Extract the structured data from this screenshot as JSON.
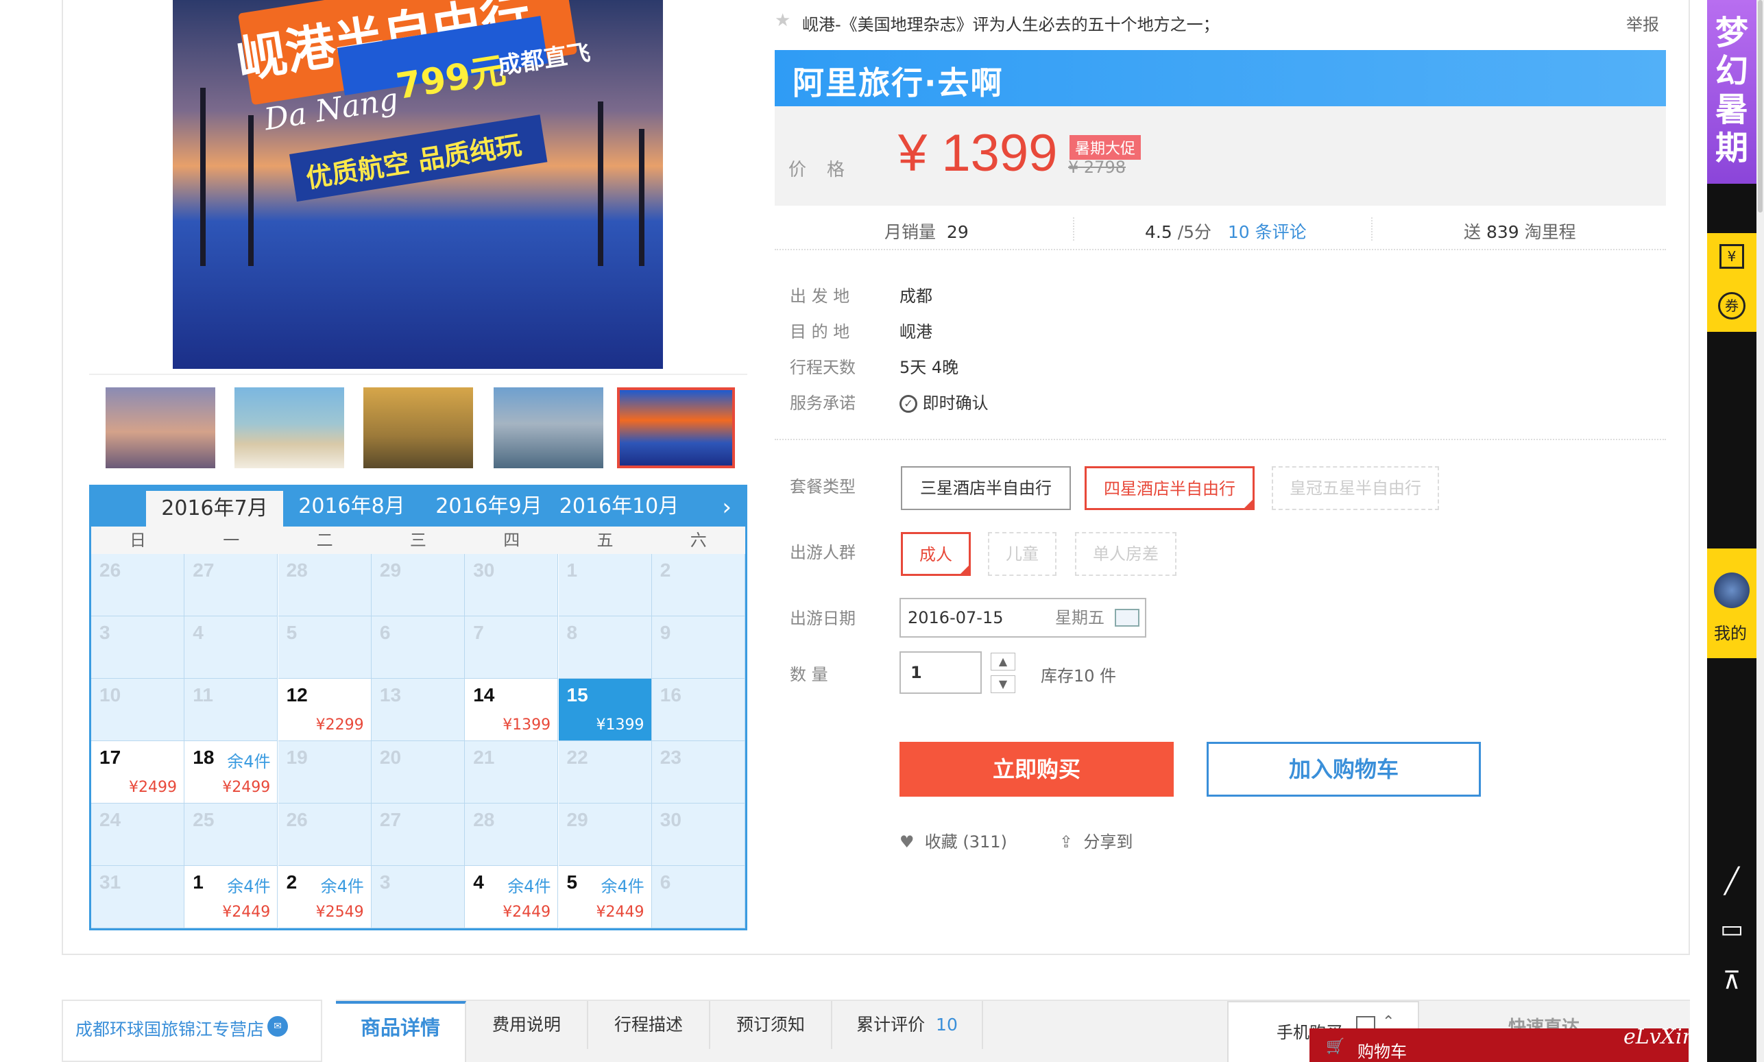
{
  "header": {
    "top_line": "岘港-《美国地理杂志》评为人生必去的五十个地方之一；",
    "report": "举报"
  },
  "gallery": {
    "banner_title": "岘港半自由行",
    "banner_price": "799元",
    "banner_flight": "成都直飞",
    "banner_script": "Da Nang",
    "banner_slogan": "优质航空  品质纯玩"
  },
  "calendar": {
    "months": [
      "2016年7月",
      "2016年8月",
      "2016年9月",
      "2016年10月"
    ],
    "active_month_index": 0,
    "weekdays": [
      "日",
      "一",
      "二",
      "三",
      "四",
      "五",
      "六"
    ],
    "rows": [
      [
        {
          "d": "26"
        },
        {
          "d": "27"
        },
        {
          "d": "28"
        },
        {
          "d": "29"
        },
        {
          "d": "30"
        },
        {
          "d": "1"
        },
        {
          "d": "2"
        }
      ],
      [
        {
          "d": "3"
        },
        {
          "d": "4"
        },
        {
          "d": "5"
        },
        {
          "d": "6"
        },
        {
          "d": "7"
        },
        {
          "d": "8"
        },
        {
          "d": "9"
        }
      ],
      [
        {
          "d": "10"
        },
        {
          "d": "11"
        },
        {
          "d": "12",
          "p": "¥2299"
        },
        {
          "d": "13"
        },
        {
          "d": "14",
          "p": "¥1399"
        },
        {
          "d": "15",
          "p": "¥1399",
          "sel": true
        },
        {
          "d": "16"
        }
      ],
      [
        {
          "d": "17",
          "p": "¥2499"
        },
        {
          "d": "18",
          "r": "余4件",
          "p": "¥2499"
        },
        {
          "d": "19"
        },
        {
          "d": "20"
        },
        {
          "d": "21"
        },
        {
          "d": "22"
        },
        {
          "d": "23"
        }
      ],
      [
        {
          "d": "24"
        },
        {
          "d": "25"
        },
        {
          "d": "26"
        },
        {
          "d": "27"
        },
        {
          "d": "28"
        },
        {
          "d": "29"
        },
        {
          "d": "30"
        }
      ],
      [
        {
          "d": "31"
        },
        {
          "d": "1",
          "r": "余4件",
          "p": "¥2449"
        },
        {
          "d": "2",
          "r": "余4件",
          "p": "¥2549"
        },
        {
          "d": "3"
        },
        {
          "d": "4",
          "r": "余4件",
          "p": "¥2449"
        },
        {
          "d": "5",
          "r": "余4件",
          "p": "¥2449"
        },
        {
          "d": "6"
        }
      ]
    ]
  },
  "product": {
    "brand": "阿里旅行·去啊",
    "price_label": "价格",
    "price": "¥ 1399",
    "promo_tag": "暑期大促",
    "original_price": "¥ 2798",
    "monthly_sales_label": "月销量",
    "monthly_sales": "29",
    "rating": "4.5",
    "rating_suffix": "/5分",
    "reviews": "10 条评论",
    "mileage_prefix": "送",
    "mileage": "839",
    "mileage_suffix": "淘里程"
  },
  "attributes": [
    {
      "label": "出 发 地",
      "value": "成都"
    },
    {
      "label": "目 的 地",
      "value": "岘港"
    },
    {
      "label": "行程天数",
      "value": "5天 4晚"
    },
    {
      "label": "服务承诺",
      "value": "即时确认"
    }
  ],
  "options": {
    "package_label": "套餐类型",
    "packages": [
      "三星酒店半自由行",
      "四星酒店半自由行",
      "皇冠五星半自由行"
    ],
    "group_label": "出游人群",
    "groups": [
      "成人",
      "儿童",
      "单人房差"
    ],
    "date_label": "出游日期",
    "date_value": "2016-07-15",
    "date_weekday": "星期五",
    "qty_label": "数    量",
    "qty_value": "1",
    "stock": "库存10 件"
  },
  "actions": {
    "buy": "立即购买",
    "cart": "加入购物车",
    "favorite": "收藏 (311)",
    "share": "分享到"
  },
  "bottom": {
    "shop_name": "成都环球国旅锦江专营店",
    "tabs": [
      "商品详情",
      "费用说明",
      "行程描述",
      "预订须知",
      "累计评价"
    ],
    "review_count": "10",
    "mobile_buy": "手机购买",
    "quick_nav": "快速直达",
    "cart_float": "购物车"
  },
  "sidebar": {
    "promo": "梦幻暑期",
    "my": "我的",
    "coupon": "券"
  },
  "watermark": "eLvXing.net"
}
